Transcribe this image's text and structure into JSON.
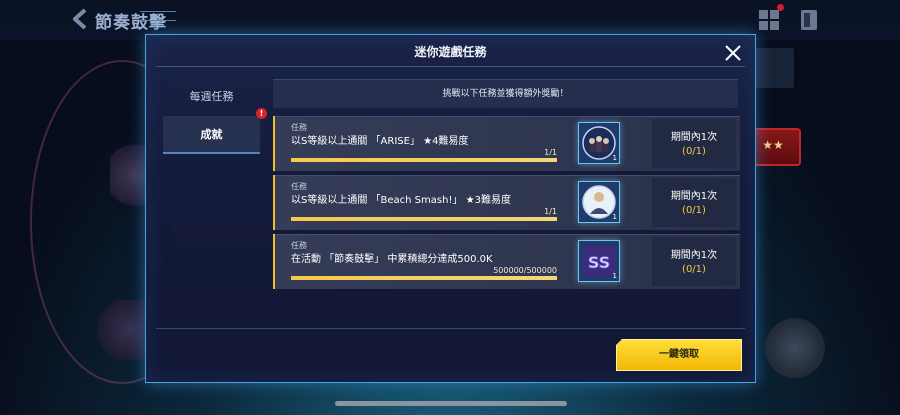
{
  "background": {
    "title": "節奏鼓擊",
    "badge_text": "★★"
  },
  "modal": {
    "title": "迷你遊戲任務",
    "close_icon": "close-icon"
  },
  "sidebar": {
    "items": [
      {
        "label": "每週任務",
        "active": false
      },
      {
        "label": "成就",
        "active": true
      }
    ],
    "badge": "!"
  },
  "banner": {
    "text": "挑戰以下任務並獲得額外獎勵！"
  },
  "missions": [
    {
      "tag": "任務",
      "description": "以S等級以上通關 「ARISE」 ★4難易度",
      "progress_text": "1/1",
      "progress_fraction": 1.0,
      "reward_icon": "band-members-reward-icon",
      "reward_count": "1",
      "period": "期間內1次",
      "count": "(0/1)"
    },
    {
      "tag": "任務",
      "description": "以S等級以上通關 「Beach Smash!」 ★3難易度",
      "progress_text": "1/1",
      "progress_fraction": 1.0,
      "reward_icon": "character-portrait-reward-icon",
      "reward_count": "1",
      "period": "期間內1次",
      "count": "(0/1)"
    },
    {
      "tag": "任務",
      "description": "在活動 「節奏鼓擊」 中累積總分達成500.0K",
      "progress_text": "500000/500000",
      "progress_fraction": 1.0,
      "reward_icon": "ss-rank-reward-icon",
      "reward_count": "1",
      "period": "期間內1次",
      "count": "(0/1)"
    }
  ],
  "claim_all": {
    "label": "一鍵領取"
  },
  "colors": {
    "accent_gold": "#f2b705",
    "frame_blue": "#4ba3d8",
    "notice_red": "#d9222c"
  }
}
